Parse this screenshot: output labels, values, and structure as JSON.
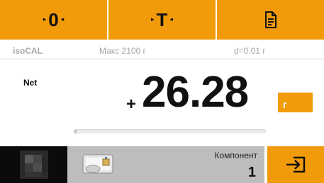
{
  "toolbar": {
    "zero_label": "0",
    "tare_label": "T",
    "document_icon": "document-icon"
  },
  "info": {
    "mode": "isoCAL",
    "max_capacity": "Макс 2100 г",
    "readability": "d=0.01 г"
  },
  "weighing": {
    "mode_label": "Net",
    "sign": "+",
    "value": "26.28",
    "unit": "г",
    "progress_fraction": 0.02
  },
  "component": {
    "label": "Компонент",
    "number": "1"
  },
  "icons": {
    "exit": "exit-icon",
    "component": "component-icon"
  },
  "colors": {
    "accent": "#f29b0a",
    "panel_gray": "#bdbdbd"
  }
}
